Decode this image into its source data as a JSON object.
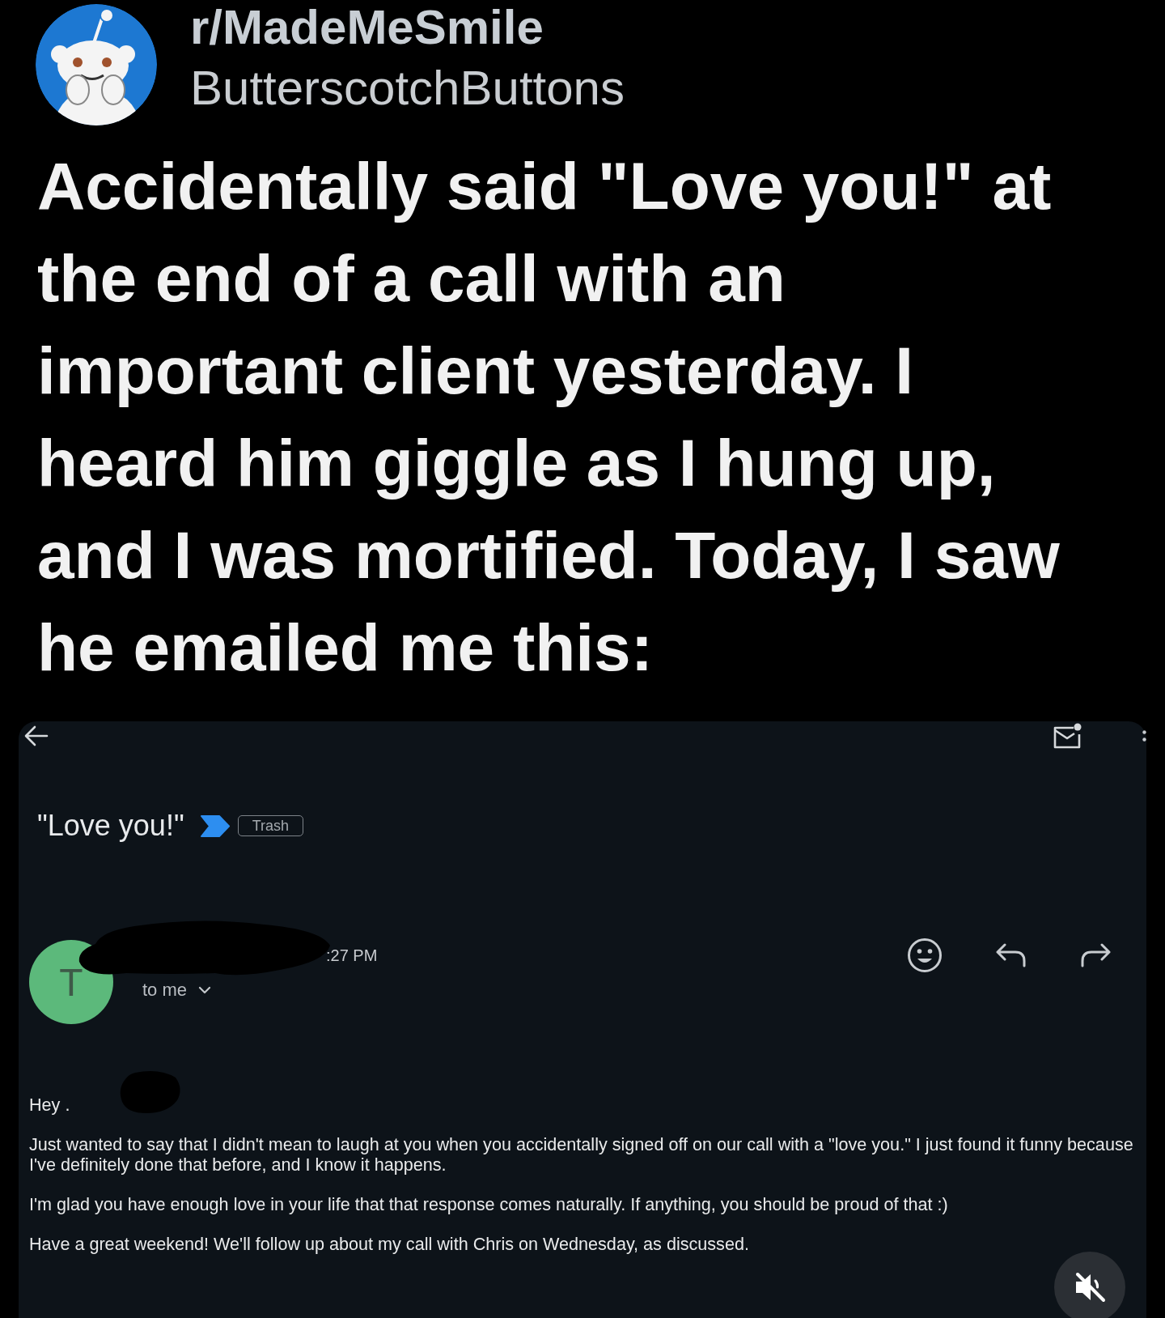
{
  "post": {
    "subreddit": "r/MadeMeSmile",
    "username": "ButterscotchButtons",
    "title": "Accidentally said \"Love you!\" at the end of a call with an important client yesterday. I heard him giggle as I hung up, and I was mortified. Today, I saw he emailed me this:"
  },
  "email": {
    "subject": "\"Love you!\"",
    "important": true,
    "label": "Trash"
  },
  "sender": {
    "initial": "T",
    "time": ":27 PM",
    "recipient": "to me"
  },
  "body": {
    "greeting": "Hey .",
    "paragraphs": [
      "Just wanted to say that I didn't mean to laugh at you when you accidentally signed off on our call with a \"love you.\" I just found it funny because I've definitely done that before, and I know it happens.",
      "I'm glad you have enough love in your life that that response comes naturally. If anything, you should be proud of that :)",
      "Have a great weekend! We'll follow up about my call with Chris on Wednesday, as discussed."
    ]
  },
  "video": {
    "muted": true
  }
}
